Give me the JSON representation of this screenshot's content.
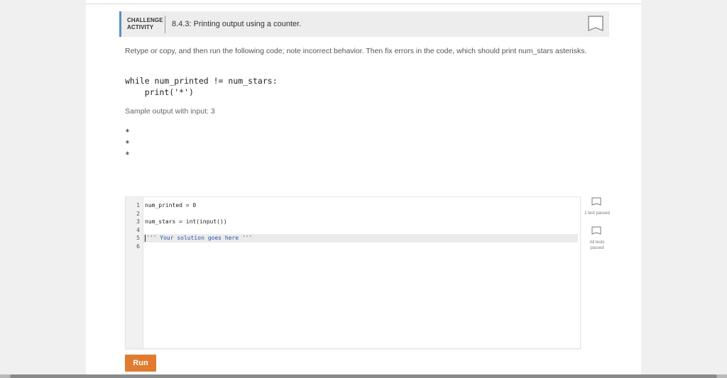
{
  "activity": {
    "label_line1": "CHALLENGE",
    "label_line2": "ACTIVITY",
    "title": "8.4.3: Printing output using a counter.",
    "accent_color": "#5b8fc8",
    "bookmark_icon": "bookmark-icon"
  },
  "instructions": "Retype or copy, and then run the following code; note incorrect behavior. Then fix errors in the code, which should print num_stars asterisks.",
  "sample_code": [
    "while num_printed != num_stars:",
    "    print('*')"
  ],
  "sample_output_label": "Sample output with input: 3",
  "sample_output": [
    "*",
    "*",
    "*"
  ],
  "editor": {
    "lines": [
      {
        "no": "1",
        "text": "num_printed = 0"
      },
      {
        "no": "2",
        "text": ""
      },
      {
        "no": "3",
        "text": "num_stars = int(input())"
      },
      {
        "no": "4",
        "text": ""
      },
      {
        "no": "5",
        "text": "''' Your solution goes here '''"
      },
      {
        "no": "6",
        "text": ""
      }
    ]
  },
  "tests": [
    {
      "label": "1 test passed",
      "icon": "checkbox-icon"
    },
    {
      "label": "All tests passed",
      "icon": "checkbox-icon"
    }
  ],
  "run_label": "Run",
  "colors": {
    "run_button": "#e07b2f",
    "string_token": "#2a55a8",
    "number_token": "#1c7a3e"
  }
}
